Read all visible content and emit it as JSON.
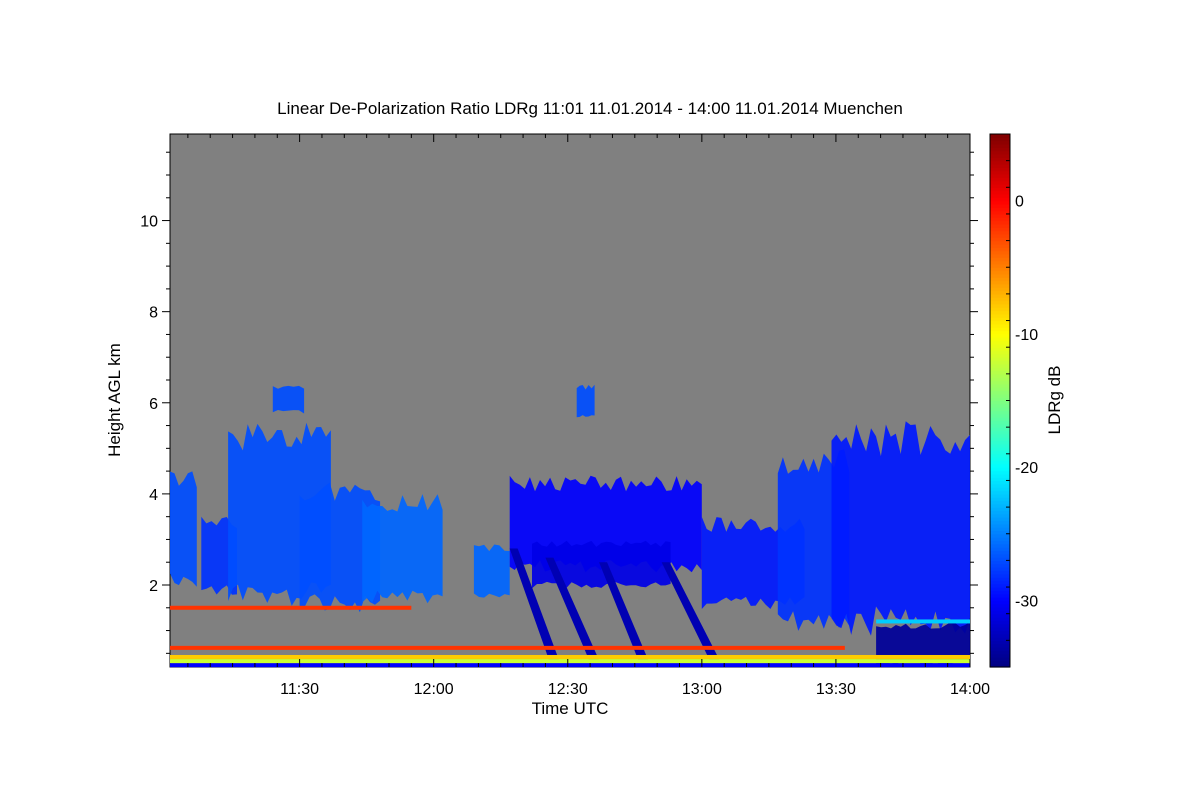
{
  "chart_data": {
    "type": "heatmap",
    "title": "Linear De-Polarization Ratio LDRg   11:01 11.01.2014 - 14:00 11.01.2014 Muenchen",
    "xlabel": "Time UTC",
    "ylabel": "Height AGL km",
    "xlim_min": [
      661,
      840
    ],
    "ylim_km": [
      0.2,
      11.9
    ],
    "x_ticks": [
      {
        "label": "11:30",
        "min": 690
      },
      {
        "label": "12:00",
        "min": 720
      },
      {
        "label": "12:30",
        "min": 750
      },
      {
        "label": "13:00",
        "min": 780
      },
      {
        "label": "13:30",
        "min": 810
      },
      {
        "label": "14:00",
        "min": 840
      }
    ],
    "y_ticks": [
      {
        "label": "2",
        "km": 2
      },
      {
        "label": "4",
        "km": 4
      },
      {
        "label": "6",
        "km": 6
      },
      {
        "label": "8",
        "km": 8
      },
      {
        "label": "10",
        "km": 10
      }
    ],
    "colorbar": {
      "label": "LDRg dB",
      "range_db": [
        -35,
        5
      ],
      "ticks": [
        {
          "label": "0",
          "db": 0
        },
        {
          "label": "-10",
          "db": -10
        },
        {
          "label": "-20",
          "db": -20
        },
        {
          "label": "-30",
          "db": -30
        }
      ],
      "colormap": "jet"
    },
    "background_color": "#808080",
    "cloud_regions": [
      {
        "t0": 661,
        "t1": 667,
        "h_base": 2.1,
        "h_top": 4.5,
        "db": -27
      },
      {
        "t0": 668,
        "t1": 676,
        "h_base": 1.9,
        "h_top": 3.5,
        "db": -28
      },
      {
        "t0": 674,
        "t1": 697,
        "h_base": 1.8,
        "h_top": 5.6,
        "db": -27
      },
      {
        "t0": 690,
        "t1": 708,
        "h_base": 1.6,
        "h_top": 4.3,
        "db": -27
      },
      {
        "t0": 704,
        "t1": 722,
        "h_base": 1.7,
        "h_top": 4.0,
        "db": -26
      },
      {
        "t0": 684,
        "t1": 691,
        "h_base": 5.8,
        "h_top": 6.4,
        "db": -27
      },
      {
        "t0": 729,
        "t1": 737,
        "h_base": 1.8,
        "h_top": 2.9,
        "db": -26
      },
      {
        "t0": 737,
        "t1": 780,
        "h_base": 2.4,
        "h_top": 4.4,
        "db": -30
      },
      {
        "t0": 742,
        "t1": 773,
        "h_base": 2.0,
        "h_top": 3.0,
        "db": -31
      },
      {
        "t0": 752,
        "t1": 756,
        "h_base": 5.7,
        "h_top": 6.4,
        "db": -27
      },
      {
        "t0": 780,
        "t1": 803,
        "h_base": 1.6,
        "h_top": 3.5,
        "db": -29
      },
      {
        "t0": 797,
        "t1": 813,
        "h_base": 1.2,
        "h_top": 5.0,
        "db": -28
      },
      {
        "t0": 809,
        "t1": 840,
        "h_base": 1.2,
        "h_top": 5.6,
        "db": -29
      },
      {
        "t0": 819,
        "t1": 840,
        "h_base": 0.3,
        "h_top": 1.2,
        "db": -34
      }
    ],
    "fall_streaks": [
      {
        "t_top": 737,
        "h_top": 2.8,
        "t_bot": 746,
        "h_bot": 0.3
      },
      {
        "t_top": 745,
        "h_top": 2.6,
        "t_bot": 755,
        "h_bot": 0.3
      },
      {
        "t_top": 757,
        "h_top": 2.5,
        "t_bot": 766,
        "h_bot": 0.3
      },
      {
        "t_top": 771,
        "h_top": 2.5,
        "t_bot": 782,
        "h_bot": 0.3
      }
    ],
    "layers": [
      {
        "t0": 661,
        "t1": 840,
        "h": 0.24,
        "db": -30
      },
      {
        "t0": 661,
        "t1": 840,
        "h": 0.33,
        "db": -12
      },
      {
        "t0": 661,
        "t1": 840,
        "h": 0.42,
        "db": -8
      },
      {
        "t0": 661,
        "t1": 812,
        "h": 0.62,
        "db": -2
      },
      {
        "t0": 661,
        "t1": 715,
        "h": 1.5,
        "db": -2
      },
      {
        "t0": 819,
        "t1": 840,
        "h": 1.2,
        "db": -22
      }
    ]
  }
}
